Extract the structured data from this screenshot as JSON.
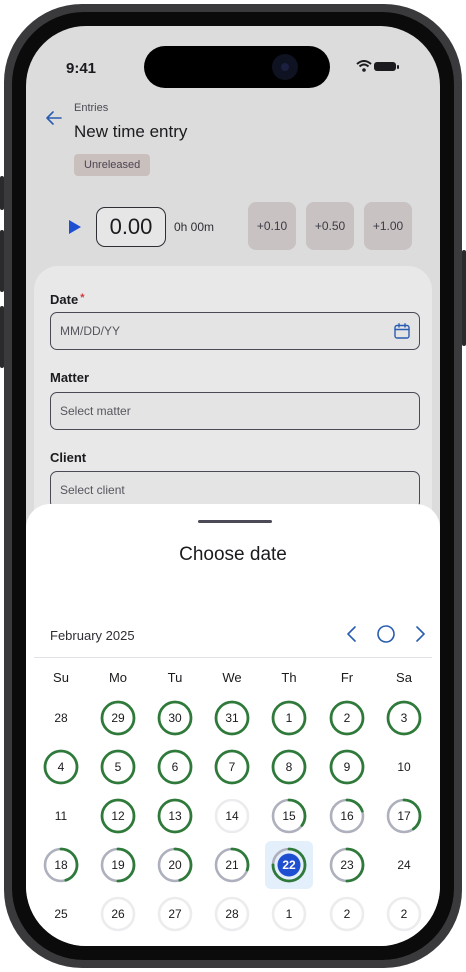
{
  "status": {
    "time": "9:41"
  },
  "header": {
    "breadcrumb": "Entries",
    "title": "New time entry",
    "badge": "Unreleased"
  },
  "timer": {
    "value": "0.00",
    "duration": "0h 00m",
    "increments": [
      "+0.10",
      "+0.50",
      "+1.00"
    ]
  },
  "form": {
    "date": {
      "label": "Date",
      "required_mark": "*",
      "placeholder": "MM/DD/YY"
    },
    "matter": {
      "label": "Matter",
      "placeholder": "Select matter"
    },
    "client": {
      "label": "Client",
      "placeholder": "Select client"
    }
  },
  "picker": {
    "title": "Choose date",
    "month": "February 2025",
    "weekdays": [
      "Su",
      "Mo",
      "Tu",
      "We",
      "Th",
      "Fr",
      "Sa"
    ],
    "weeks": [
      [
        "28",
        "29",
        "30",
        "31",
        "1",
        "2",
        "3"
      ],
      [
        "4",
        "5",
        "6",
        "7",
        "8",
        "9",
        "10"
      ],
      [
        "11",
        "12",
        "13",
        "14",
        "15",
        "16",
        "17"
      ],
      [
        "18",
        "19",
        "20",
        "21",
        "22",
        "23",
        "24"
      ],
      [
        "25",
        "26",
        "27",
        "28",
        "1",
        "2",
        "2"
      ]
    ],
    "progress": [
      [
        null,
        1,
        1,
        1,
        1,
        1,
        1
      ],
      [
        1,
        1,
        1,
        1,
        1,
        1,
        null
      ],
      [
        null,
        1,
        1,
        0,
        0.35,
        0.2,
        0.4
      ],
      [
        0.45,
        0.5,
        0.45,
        0.3,
        0.75,
        0.5,
        null
      ],
      [
        null,
        0,
        0,
        0,
        0,
        0,
        0
      ]
    ],
    "selected": {
      "week": 3,
      "day": 4
    }
  },
  "colors": {
    "progress": "#2f7a3b",
    "partial": "#aeb1bd",
    "selected": "#1f4fd1",
    "accent": "#2a5db0"
  }
}
